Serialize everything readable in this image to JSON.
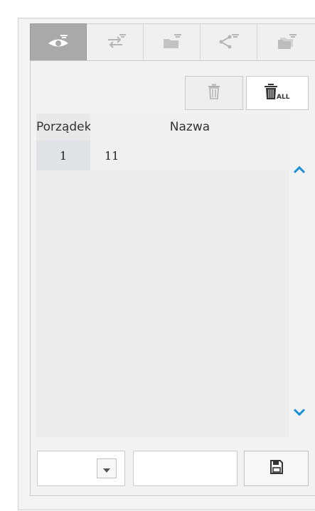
{
  "tabs": [
    {
      "icon": "eye-icon",
      "active": true
    },
    {
      "icon": "swap-icon",
      "active": false
    },
    {
      "icon": "folder-icon",
      "active": false
    },
    {
      "icon": "share-icon",
      "active": false
    },
    {
      "icon": "folder-stack-icon",
      "active": false
    }
  ],
  "toolbar": {
    "delete_icon": "trash-icon",
    "delete_all_icon": "trash-all-icon",
    "delete_all_badge": "ALL"
  },
  "table": {
    "headers": {
      "order": "Porządek",
      "name": "Nazwa"
    },
    "rows": [
      {
        "order": "1",
        "name": "11"
      }
    ]
  },
  "scroll": {
    "up_icon": "chevron-up-icon",
    "down_icon": "chevron-down-icon",
    "accent": "#1a8fd8"
  },
  "bottom": {
    "select_value": "",
    "input_value": "",
    "save_icon": "floppy-disk-icon"
  },
  "colors": {
    "active_tab": "#a9a9a9",
    "panel": "#f4f4f4",
    "icon_gray": "#8a8a8a",
    "icon_dark": "#333333"
  }
}
